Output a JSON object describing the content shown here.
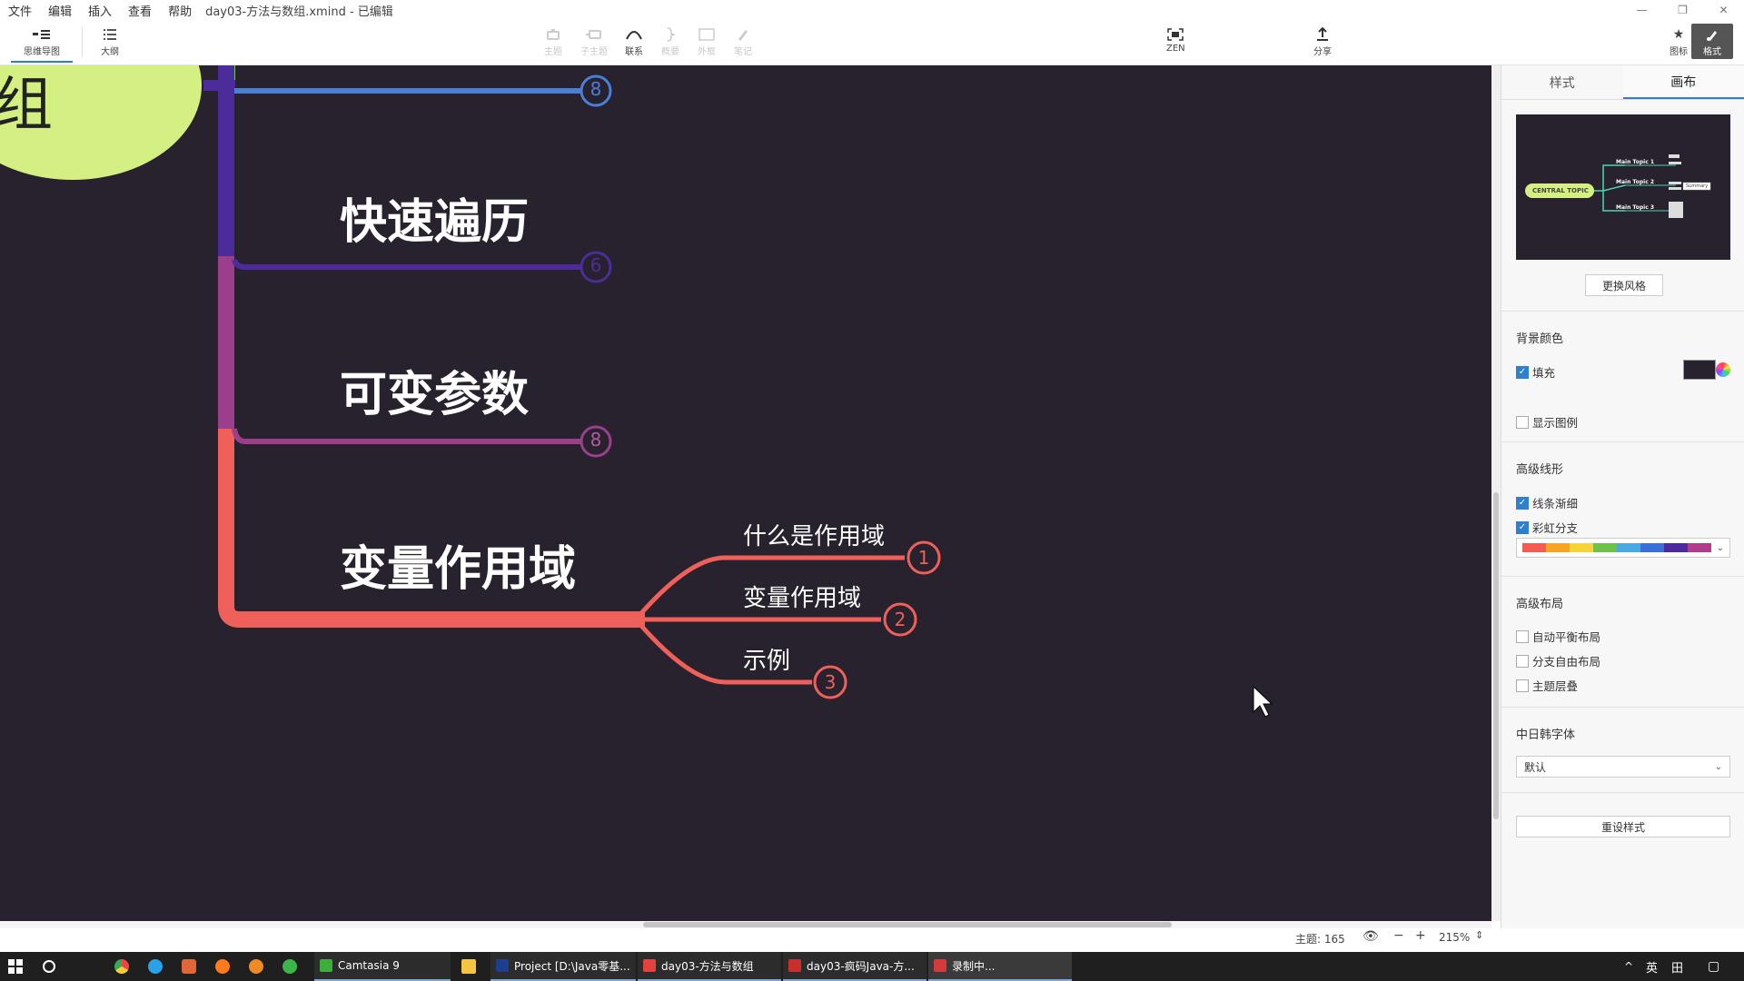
{
  "window": {
    "menus": [
      "文件",
      "编辑",
      "插入",
      "查看",
      "帮助"
    ],
    "title": "day03-方法与数组.xmind - 已编辑",
    "controls": [
      "—",
      "❐",
      "✕"
    ]
  },
  "toolbar": {
    "mindmap_label": "思维导图",
    "outline_label": "大纲",
    "topic_label": "主题",
    "subtopic_label": "子主题",
    "relation_label": "联系",
    "summary_label": "概要",
    "boundary_label": "外框",
    "note_label": "笔记",
    "zen_label": "ZEN",
    "share_label": "分享",
    "icon_label": "图标",
    "format_label": "格式"
  },
  "canvas": {
    "central_fragment": "组",
    "branches": [
      {
        "label": "",
        "count": "8",
        "color": "#4a7fd6"
      },
      {
        "label": "快速遍历",
        "count": "6",
        "color": "#4b2c9a"
      },
      {
        "label": "可变参数",
        "count": "8",
        "color": "#9b3f8c"
      },
      {
        "label": "变量作用域",
        "count": "",
        "color": "#f0605a"
      }
    ],
    "subtopics": [
      {
        "label": "什么是作用域",
        "count": "1"
      },
      {
        "label": "变量作用域",
        "count": "2"
      },
      {
        "label": "示例",
        "count": "3"
      }
    ]
  },
  "panel": {
    "tab_style": "样式",
    "tab_canvas": "画布",
    "preview": {
      "central": "CENTRAL TOPIC",
      "topics": [
        "Main Topic 1",
        "Main Topic 2",
        "Main Topic 3"
      ],
      "summary": "Summary"
    },
    "change_style": "更换风格",
    "bg_color_heading": "背景颜色",
    "fill_label": "填充",
    "fill_checked": true,
    "legend_label": "显示图例",
    "legend_checked": false,
    "advanced_line_heading": "高级线形",
    "taper_label": "线条渐细",
    "taper_checked": true,
    "rainbow_label": "彩虹分支",
    "rainbow_checked": true,
    "rainbow_colors": [
      "#f25c54",
      "#f7a325",
      "#f6d23b",
      "#6cc24a",
      "#49a9e0",
      "#3a6fd8",
      "#4b2c9a",
      "#b03c8c"
    ],
    "advanced_layout_heading": "高级布局",
    "auto_balance_label": "自动平衡布局",
    "free_branch_label": "分支自由布局",
    "overlap_label": "主题层叠",
    "cjk_font_heading": "中日韩字体",
    "cjk_font_value": "默认",
    "reset_label": "重设样式"
  },
  "status": {
    "topic_count": "主题: 165",
    "zoom": "215%"
  },
  "taskbar": {
    "apps": [
      {
        "label": "Camtasia 9",
        "color": "#3dae3b"
      },
      {
        "label": "Project [D:\\Java零基...",
        "color": "#1d3f8f"
      },
      {
        "label": "day03-方法与数组",
        "color": "#e3433d"
      },
      {
        "label": "day03-疯码Java-方...",
        "color": "#c8312b"
      },
      {
        "label": "录制中...",
        "color": "#d63b3b"
      }
    ],
    "tray": [
      "^",
      "英",
      "田",
      "▢"
    ]
  }
}
